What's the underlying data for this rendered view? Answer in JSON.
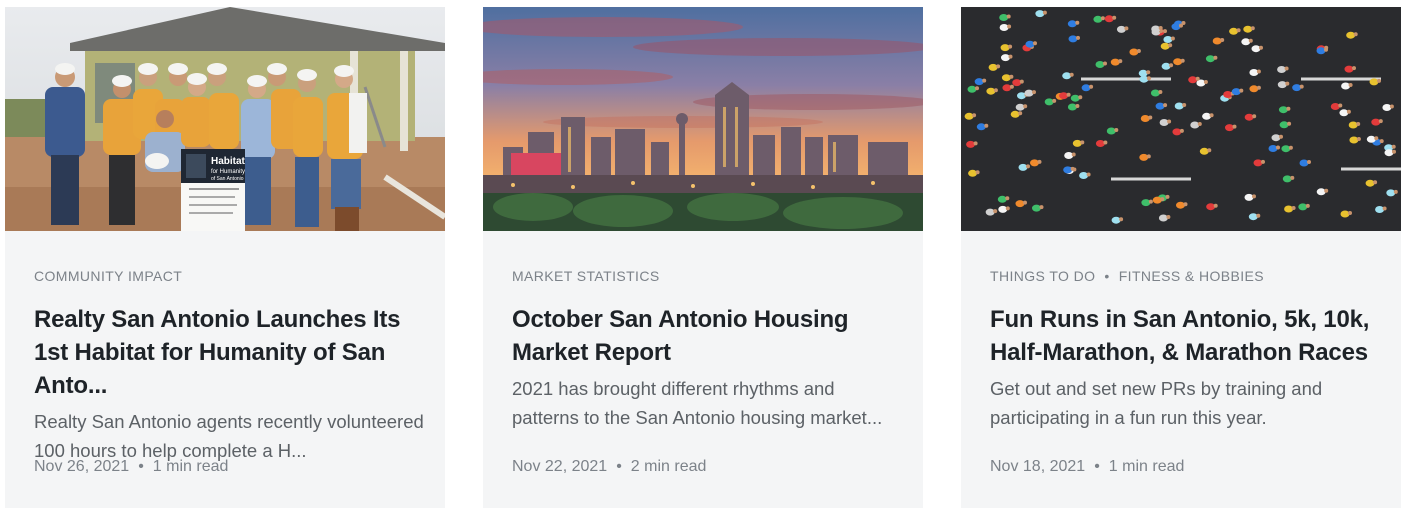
{
  "posts": [
    {
      "image_alt": "Volunteers in hard hats posing in front of a new home with a Habitat for Humanity sign",
      "categories": [
        "COMMUNITY IMPACT"
      ],
      "title": "Realty San Antonio Launches Its 1st Habitat for Humanity of San Anto...",
      "excerpt": "Realty San Antonio agents recently volunteered 100 hours to help complete a H...",
      "date": "Nov 26, 2021",
      "read_time": "1 min read",
      "sign_text": [
        "Habitat",
        "for Humanity",
        "of San Antonio"
      ]
    },
    {
      "image_alt": "San Antonio skyline at sunset",
      "categories": [
        "MARKET STATISTICS"
      ],
      "title": "October San Antonio Housing Market Report",
      "excerpt": "2021 has brought different rhythms and patterns to the San Antonio housing market...",
      "date": "Nov 22, 2021",
      "read_time": "2 min read"
    },
    {
      "image_alt": "Aerial view of runners in a race",
      "categories": [
        "THINGS TO DO",
        "FITNESS & HOBBIES"
      ],
      "title": "Fun Runs in San Antonio, 5k, 10k, Half-Marathon, & Marathon Races",
      "excerpt": "Get out and set new PRs by training and participating in a fun run this year.",
      "date": "Nov 18, 2021",
      "read_time": "1 min read"
    }
  ],
  "separators": {
    "category": "•",
    "meta": "•"
  },
  "colors": {
    "card_bg": "#f4f5f6",
    "title": "#1e2328",
    "excerpt": "#5c6166",
    "muted": "#7c8289"
  }
}
